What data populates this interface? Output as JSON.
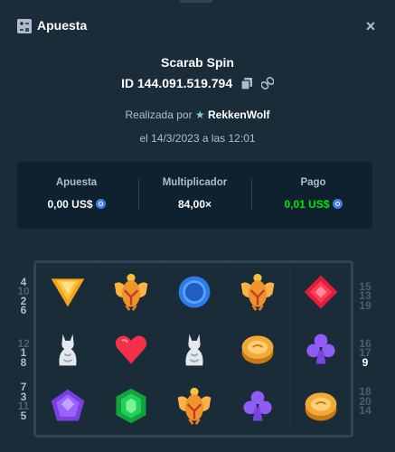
{
  "modal": {
    "title": "Apuesta",
    "close_label": "×"
  },
  "bet": {
    "game_name": "Scarab Spin",
    "id_text": "ID 144.091.519.794",
    "placed_by_prefix": "Realizada por",
    "user": "RekkenWolf",
    "date_text": "el 14/3/2023 a las 12:01"
  },
  "stats": {
    "bet_label": "Apuesta",
    "bet_value": "0,00 US$",
    "multiplier_label": "Multiplicador",
    "multiplier_value": "84,00×",
    "payout_label": "Pago",
    "payout_value": "0,01 US$"
  },
  "colors": {
    "background": "#1a2c38",
    "panel": "#0f212e",
    "payout_green": "#00e701",
    "coin_blue": "#3e80e4"
  },
  "reels": [
    [
      "orange-triangle-gem",
      "white-cat-statue",
      "purple-pentagon-gem"
    ],
    [
      "golden-scarab",
      "red-heart",
      "green-hexagon-gem"
    ],
    [
      "blue-ring-gem",
      "white-cat-statue",
      "golden-scarab"
    ],
    [
      "golden-scarab",
      "gold-coin",
      "purple-club"
    ],
    [
      "red-diamond-gem",
      "purple-club",
      "gold-coin"
    ]
  ],
  "paylines": {
    "left": [
      [
        {
          "n": "4",
          "s": "lit"
        },
        {
          "n": "10",
          "s": "dim"
        },
        {
          "n": "2",
          "s": "lit"
        },
        {
          "n": "6",
          "s": "lit"
        }
      ],
      [
        {
          "n": "12",
          "s": "dim"
        },
        {
          "n": "1",
          "s": "lit"
        },
        {
          "n": "8",
          "s": "lit"
        }
      ],
      [
        {
          "n": "7",
          "s": "lit"
        },
        {
          "n": "3",
          "s": "lit"
        },
        {
          "n": "11",
          "s": "dim"
        },
        {
          "n": "5",
          "s": "lit"
        }
      ]
    ],
    "right": [
      [
        {
          "n": "15",
          "s": "dim"
        },
        {
          "n": "13",
          "s": "dim"
        },
        {
          "n": "19",
          "s": "dim"
        }
      ],
      [
        {
          "n": "16",
          "s": "dim"
        },
        {
          "n": "17",
          "s": "dim"
        },
        {
          "n": "9",
          "s": "win"
        }
      ],
      [
        {
          "n": "18",
          "s": "dim"
        },
        {
          "n": "20",
          "s": "dim"
        },
        {
          "n": "14",
          "s": "dim"
        }
      ]
    ]
  }
}
